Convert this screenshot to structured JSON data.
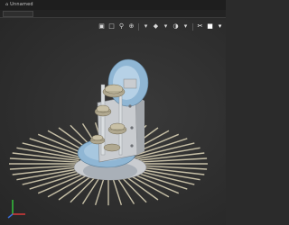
{
  "window": {
    "title": "⌂ Unnamed"
  },
  "toolbar": {
    "buttons": [
      {
        "icon": "view-cube-icon",
        "glyph": "▣"
      },
      {
        "icon": "fit-view-icon",
        "glyph": "□"
      },
      {
        "icon": "search-icon",
        "glyph": "⚲"
      },
      {
        "icon": "zoom-icon",
        "glyph": "⊕"
      },
      {
        "icon": "dropdown-icon",
        "glyph": "▾"
      },
      {
        "icon": "shape-icon",
        "glyph": "◆"
      },
      {
        "icon": "dropdown-icon",
        "glyph": "▾"
      },
      {
        "icon": "render-mode-icon",
        "glyph": "◑"
      },
      {
        "icon": "dropdown-icon",
        "glyph": "▾"
      },
      {
        "icon": "section-icon",
        "glyph": "✂"
      },
      {
        "icon": "display-icon",
        "glyph": "■"
      },
      {
        "icon": "dropdown-icon",
        "glyph": "▾"
      },
      {
        "icon": "appearance-icon",
        "glyph": "●"
      },
      {
        "icon": "dropdown-icon",
        "glyph": "▾"
      },
      {
        "icon": "scene-icon",
        "glyph": "◎"
      },
      {
        "icon": "dropdown-icon",
        "glyph": "▾"
      },
      {
        "icon": "monitor-icon",
        "glyph": "▭"
      },
      {
        "icon": "dropdown-icon",
        "glyph": "▾"
      }
    ]
  },
  "colors": {
    "background": "#2d2d2d",
    "gear_metal": "#b0a890",
    "housing_blue": "#8fb6d4",
    "bracket_grey": "#c9ccd0",
    "rods": "#d8d0b4",
    "axis_x": "#d83a3a",
    "axis_y": "#34c23c",
    "axis_z": "#3a6fd8"
  }
}
